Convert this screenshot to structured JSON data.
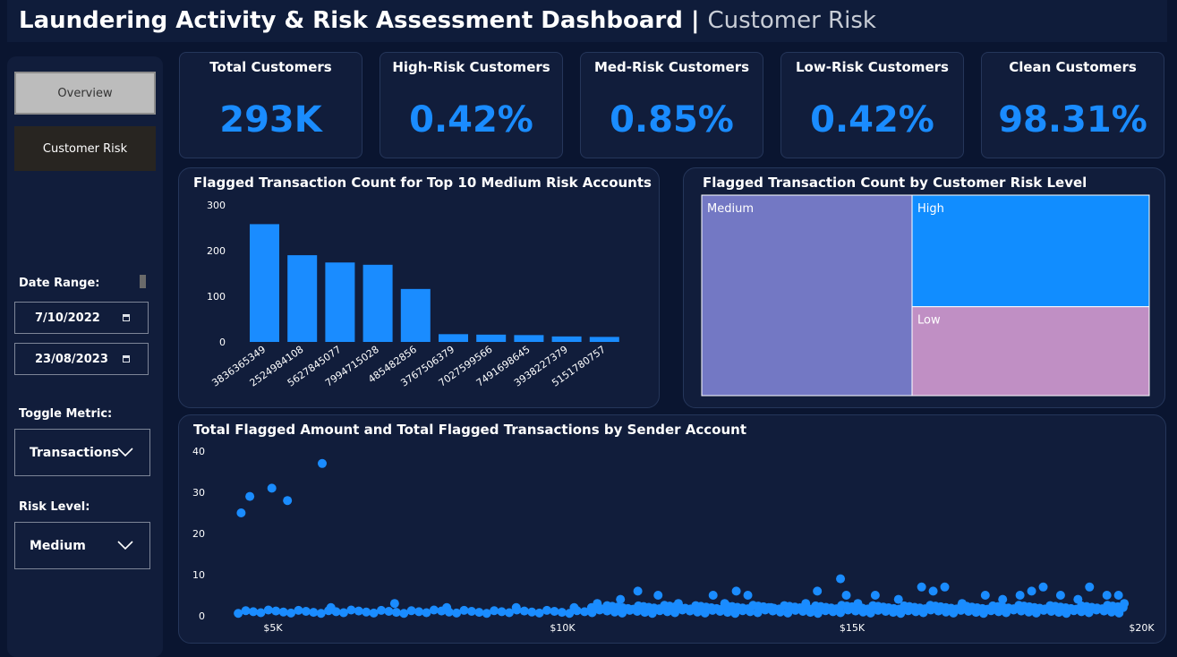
{
  "header": {
    "title": "Laundering Activity & Risk Assessment Dashboard",
    "separator": "|",
    "subtitle": "Customer Risk"
  },
  "sidebar": {
    "nav": [
      {
        "label": "Overview",
        "active": false
      },
      {
        "label": "Customer Risk",
        "active": true
      }
    ],
    "date_range_label": "Date Range:",
    "date_start": "7/10/2022",
    "date_end": "23/08/2023",
    "toggle_metric_label": "Toggle Metric:",
    "toggle_metric_value": "Transactions",
    "risk_level_label": "Risk Level:",
    "risk_level_value": "Medium"
  },
  "kpis": [
    {
      "label": "Total Customers",
      "value": "293K"
    },
    {
      "label": "High-Risk Customers",
      "value": "0.42%"
    },
    {
      "label": "Med-Risk Customers",
      "value": "0.85%"
    },
    {
      "label": "Low-Risk Customers",
      "value": "0.42%"
    },
    {
      "label": "Clean Customers",
      "value": "98.31%"
    }
  ],
  "colors": {
    "accent": "#1a8cff",
    "medium": "#7378c4",
    "high": "#118dff",
    "low": "#c08fc4"
  },
  "chart_data": [
    {
      "type": "bar",
      "title": "Flagged Transaction Count for Top 10 Medium Risk Accounts",
      "categories": [
        "3836365349",
        "2524984108",
        "5627845077",
        "7994715028",
        "485482856",
        "3767506379",
        "7027599566",
        "7491698645",
        "3938227379",
        "5151780757"
      ],
      "values": [
        258,
        190,
        174,
        169,
        116,
        17,
        16,
        15,
        12,
        11
      ],
      "ylim": [
        0,
        300
      ],
      "yticks": [
        0,
        100,
        200,
        300
      ]
    },
    {
      "type": "treemap",
      "title": "Flagged Transaction Count by Customer Risk Level",
      "categories": [
        "Medium",
        "High",
        "Low"
      ],
      "values": [
        0.47,
        0.295,
        0.235
      ]
    },
    {
      "type": "scatter",
      "title": "Total Flagged Amount and Total Flagged Transactions by Sender Account",
      "xlim": [
        4000,
        20000
      ],
      "ylim": [
        0,
        40
      ],
      "xticks": [
        {
          "v": 5000,
          "label": "$5K"
        },
        {
          "v": 10000,
          "label": "$10K"
        },
        {
          "v": 15000,
          "label": "$15K"
        },
        {
          "v": 20000,
          "label": "$20K"
        }
      ],
      "yticks": [
        0,
        10,
        20,
        30,
        40
      ],
      "outliers": [
        [
          4450,
          25
        ],
        [
          4600,
          29
        ],
        [
          4980,
          31
        ],
        [
          5250,
          28
        ],
        [
          5850,
          37
        ],
        [
          14800,
          9
        ]
      ],
      "scattered": [
        [
          6000,
          2
        ],
        [
          7100,
          3
        ],
        [
          8000,
          2
        ],
        [
          9200,
          2
        ],
        [
          10200,
          2
        ],
        [
          10600,
          3
        ],
        [
          11000,
          4
        ],
        [
          11300,
          6
        ],
        [
          11650,
          5
        ],
        [
          12000,
          3
        ],
        [
          12600,
          5
        ],
        [
          12800,
          3
        ],
        [
          13000,
          6
        ],
        [
          13200,
          5
        ],
        [
          13600,
          2
        ],
        [
          14200,
          3
        ],
        [
          14400,
          6
        ],
        [
          14900,
          5
        ],
        [
          15100,
          3
        ],
        [
          15400,
          5
        ],
        [
          15800,
          4
        ],
        [
          16200,
          7
        ],
        [
          16400,
          6
        ],
        [
          16600,
          7
        ],
        [
          16900,
          3
        ],
        [
          17300,
          5
        ],
        [
          17600,
          4
        ],
        [
          17900,
          5
        ],
        [
          18100,
          6
        ],
        [
          18300,
          7
        ],
        [
          18600,
          5
        ],
        [
          18900,
          4
        ],
        [
          19100,
          7
        ],
        [
          19400,
          5
        ],
        [
          19600,
          5
        ],
        [
          19700,
          3
        ]
      ]
    }
  ]
}
